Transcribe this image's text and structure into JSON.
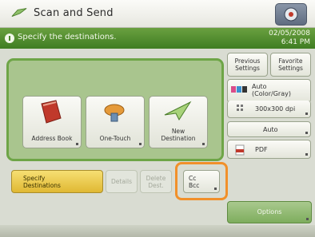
{
  "title": "Scan and Send",
  "instruction": "Specify the destinations.",
  "datetime": [
    "02/05/2008",
    "6:41 PM"
  ],
  "destination_buttons": [
    {
      "label": "Address Book",
      "icon": "address-book-icon"
    },
    {
      "label": "One-Touch",
      "icon": "one-touch-icon"
    },
    {
      "label": [
        "New",
        "Destination"
      ],
      "icon": "new-destination-icon"
    }
  ],
  "right_panel": {
    "previous_settings": [
      "Previous",
      "Settings"
    ],
    "favorite_settings": [
      "Favorite",
      "Settings"
    ],
    "color_mode": [
      "Auto",
      "(Color/Gray)"
    ],
    "resolution": "300x300 dpi",
    "density": "Auto",
    "file_format": "PDF"
  },
  "bottom_buttons": {
    "specify": [
      "Specify",
      "Destinations"
    ],
    "details": "Details",
    "delete": [
      "Delete",
      "Dest."
    ],
    "send_to": [
      "Cc",
      "Bcc"
    ]
  },
  "options_label": "Options",
  "colors": {
    "accent_green": "#4f8a2c",
    "highlight_orange": "#f1902a",
    "specify_yellow": "#e9c74b"
  }
}
